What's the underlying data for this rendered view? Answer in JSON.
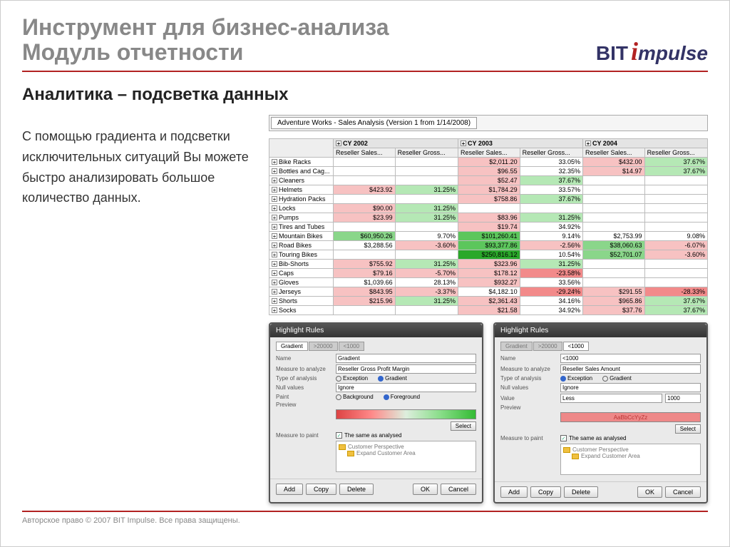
{
  "header": {
    "title_line1": "Инструмент для бизнес-анализа",
    "title_line2": "Модуль отчетности",
    "logo_bit": "BIT",
    "logo_mpulse": "mpulse"
  },
  "subtitle": "Аналитика – подсветка данных",
  "left_text": "С помощью градиента и подсветки исключительных ситуаций Вы можете быстро анализировать большое количество данных.",
  "report_tab": "Adventure Works - Sales Analysis (Version 1 from 1/14/2008)",
  "year_headers": [
    "CY 2002",
    "CY 2003",
    "CY 2004"
  ],
  "col_headers": [
    "Reseller Sales...",
    "Reseller Gross...",
    "Reseller Sales...",
    "Reseller Gross...",
    "Reseller Sales...",
    "Reseller Gross..."
  ],
  "rows": [
    {
      "label": "Bike Racks",
      "cells": [
        {
          "v": ""
        },
        {
          "v": ""
        },
        {
          "v": "$2,011.20",
          "c": "#f7c2c2"
        },
        {
          "v": "33.05%"
        },
        {
          "v": "$432.00",
          "c": "#f7c2c2"
        },
        {
          "v": "37.67%",
          "c": "#b5e8b5"
        }
      ]
    },
    {
      "label": "Bottles and Cag...",
      "cells": [
        {
          "v": ""
        },
        {
          "v": ""
        },
        {
          "v": "$96.55",
          "c": "#f7c2c2"
        },
        {
          "v": "32.35%"
        },
        {
          "v": "$14.97",
          "c": "#f7c2c2"
        },
        {
          "v": "37.67%",
          "c": "#b5e8b5"
        }
      ]
    },
    {
      "label": "Cleaners",
      "cells": [
        {
          "v": ""
        },
        {
          "v": ""
        },
        {
          "v": "$52.47",
          "c": "#f7c2c2"
        },
        {
          "v": "37.67%",
          "c": "#b5e8b5"
        },
        {
          "v": ""
        },
        {
          "v": ""
        }
      ]
    },
    {
      "label": "Helmets",
      "cells": [
        {
          "v": "$423.92",
          "c": "#f7c2c2"
        },
        {
          "v": "31.25%",
          "c": "#b5e8b5"
        },
        {
          "v": "$1,784.29",
          "c": "#f7c2c2"
        },
        {
          "v": "33.57%"
        },
        {
          "v": ""
        },
        {
          "v": ""
        }
      ]
    },
    {
      "label": "Hydration Packs",
      "cells": [
        {
          "v": ""
        },
        {
          "v": ""
        },
        {
          "v": "$758.86",
          "c": "#f7c2c2"
        },
        {
          "v": "37.67%",
          "c": "#b5e8b5"
        },
        {
          "v": ""
        },
        {
          "v": ""
        }
      ]
    },
    {
      "label": "Locks",
      "cells": [
        {
          "v": "$90.00",
          "c": "#f7c2c2"
        },
        {
          "v": "31.25%",
          "c": "#b5e8b5"
        },
        {
          "v": ""
        },
        {
          "v": ""
        },
        {
          "v": ""
        },
        {
          "v": ""
        }
      ]
    },
    {
      "label": "Pumps",
      "cells": [
        {
          "v": "$23.99",
          "c": "#f7c2c2"
        },
        {
          "v": "31.25%",
          "c": "#b5e8b5"
        },
        {
          "v": "$83.96",
          "c": "#f7c2c2"
        },
        {
          "v": "31.25%",
          "c": "#b5e8b5"
        },
        {
          "v": ""
        },
        {
          "v": ""
        }
      ]
    },
    {
      "label": "Tires and Tubes",
      "cells": [
        {
          "v": ""
        },
        {
          "v": ""
        },
        {
          "v": "$19.74",
          "c": "#f7c2c2"
        },
        {
          "v": "34.92%"
        },
        {
          "v": ""
        },
        {
          "v": ""
        }
      ]
    },
    {
      "label": "Mountain Bikes",
      "cells": [
        {
          "v": "$60,950.26",
          "c": "#8ad68a"
        },
        {
          "v": "9.70%"
        },
        {
          "v": "$101,260.41",
          "c": "#5cc65c"
        },
        {
          "v": "9.14%"
        },
        {
          "v": "$2,753.99"
        },
        {
          "v": "9.08%"
        }
      ]
    },
    {
      "label": "Road Bikes",
      "cells": [
        {
          "v": "$3,288.56"
        },
        {
          "v": "-3.60%",
          "c": "#f7c2c2"
        },
        {
          "v": "$93,377.86",
          "c": "#5cc65c"
        },
        {
          "v": "-2.56%",
          "c": "#f7c2c2"
        },
        {
          "v": "$38,060.63",
          "c": "#8ad68a"
        },
        {
          "v": "-6.07%",
          "c": "#f7c2c2"
        }
      ]
    },
    {
      "label": "Touring Bikes",
      "cells": [
        {
          "v": ""
        },
        {
          "v": ""
        },
        {
          "v": "$250,816.12",
          "c": "#2aa82a"
        },
        {
          "v": "10.54%"
        },
        {
          "v": "$52,701.07",
          "c": "#8ad68a"
        },
        {
          "v": "-3.60%",
          "c": "#f7c2c2"
        }
      ]
    },
    {
      "label": "Bib-Shorts",
      "cells": [
        {
          "v": "$755.92",
          "c": "#f7c2c2"
        },
        {
          "v": "31.25%",
          "c": "#b5e8b5"
        },
        {
          "v": "$323.96",
          "c": "#f7c2c2"
        },
        {
          "v": "31.25%",
          "c": "#b5e8b5"
        },
        {
          "v": ""
        },
        {
          "v": ""
        }
      ]
    },
    {
      "label": "Caps",
      "cells": [
        {
          "v": "$79.16",
          "c": "#f7c2c2"
        },
        {
          "v": "-5.70%",
          "c": "#f7c2c2"
        },
        {
          "v": "$178.12",
          "c": "#f7c2c2"
        },
        {
          "v": "-23.58%",
          "c": "#f28a8a"
        },
        {
          "v": ""
        },
        {
          "v": ""
        }
      ]
    },
    {
      "label": "Gloves",
      "cells": [
        {
          "v": "$1,039.66"
        },
        {
          "v": "28.13%"
        },
        {
          "v": "$932.27",
          "c": "#f7c2c2"
        },
        {
          "v": "33.56%"
        },
        {
          "v": ""
        },
        {
          "v": ""
        }
      ]
    },
    {
      "label": "Jerseys",
      "cells": [
        {
          "v": "$843.95",
          "c": "#f7c2c2"
        },
        {
          "v": "-3.37%",
          "c": "#f7c2c2"
        },
        {
          "v": "$4,182.10"
        },
        {
          "v": "-29.24%",
          "c": "#f28a8a"
        },
        {
          "v": "$291.55",
          "c": "#f7c2c2"
        },
        {
          "v": "-28.33%",
          "c": "#f28a8a"
        }
      ]
    },
    {
      "label": "Shorts",
      "cells": [
        {
          "v": "$215.96",
          "c": "#f7c2c2"
        },
        {
          "v": "31.25%",
          "c": "#b5e8b5"
        },
        {
          "v": "$2,361.43",
          "c": "#f7c2c2"
        },
        {
          "v": "34.16%"
        },
        {
          "v": "$965.86",
          "c": "#f7c2c2"
        },
        {
          "v": "37.67%",
          "c": "#b5e8b5"
        }
      ]
    },
    {
      "label": "Socks",
      "cells": [
        {
          "v": ""
        },
        {
          "v": ""
        },
        {
          "v": "$21.58",
          "c": "#f7c2c2"
        },
        {
          "v": "34.92%"
        },
        {
          "v": "$37.76",
          "c": "#f7c2c2"
        },
        {
          "v": "37.67%",
          "c": "#b5e8b5"
        }
      ]
    }
  ],
  "dialog1": {
    "title": "Highlight Rules",
    "tabs": [
      "Gradient",
      ">20000",
      "<1000"
    ],
    "name_label": "Name",
    "name_value": "Gradient",
    "measure_label": "Measure to analyze",
    "measure_value": "Reseller Gross Profit Margin",
    "type_label": "Type of analysis",
    "type_exception": "Exception",
    "type_gradient": "Gradient",
    "null_label": "Null values",
    "null_value": "Ignore",
    "paint_label": "Paint",
    "paint_bg": "Background",
    "paint_fg": "Foreground",
    "preview_label": "Preview",
    "measure_paint_label": "Measure to paint",
    "same_as": "The same as analysed",
    "tree_items": [
      "Customer Perspective",
      "Expand Customer Area"
    ],
    "select": "Select"
  },
  "dialog2": {
    "title": "Highlight Rules",
    "tabs": [
      "Gradient",
      ">20000",
      "<1000"
    ],
    "name_value": "<1000",
    "measure_value": "Reseller Sales Amount",
    "type_exception_sel": true,
    "value_label": "Value",
    "value_op": "Less",
    "value_num": "1000",
    "preview_text": "AaBbCcYyZz"
  },
  "buttons": {
    "add": "Add",
    "copy": "Copy",
    "delete": "Delete",
    "ok": "OK",
    "cancel": "Cancel"
  },
  "footer": "Авторское право © 2007 BIT Impulse. Все права защищены."
}
